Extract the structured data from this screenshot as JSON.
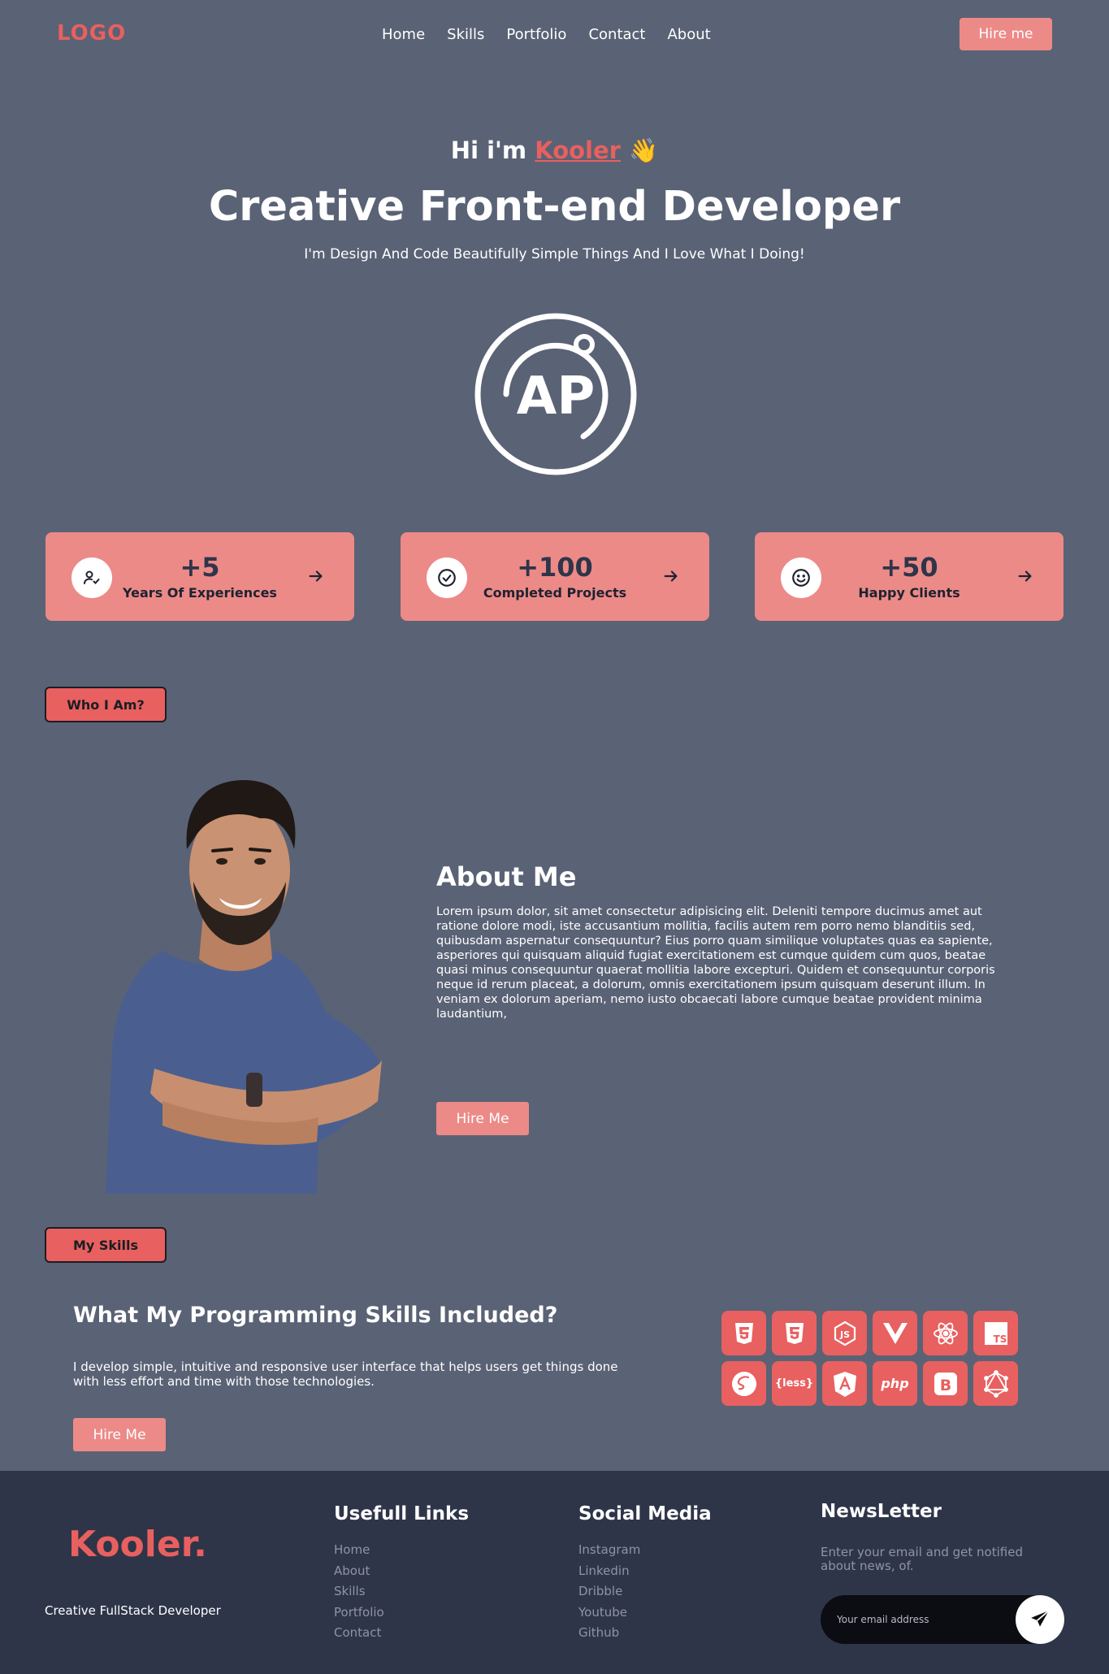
{
  "nav": {
    "logo": "LOGO",
    "links": [
      "Home",
      "Skills",
      "Portfolio",
      "Contact",
      "About"
    ],
    "hire_label": "Hire me"
  },
  "hero": {
    "greeting_prefix": "Hi i'm",
    "name": "Kooler",
    "wave_emoji": "👋",
    "title": "Creative Front-end Developer",
    "subtitle": "I'm Design And Code Beautifully Simple Things And I Love What I Doing!",
    "logo_letters": "AP"
  },
  "stats": [
    {
      "value": "+5",
      "label": "Years Of Experiences",
      "icon": "user-check-icon"
    },
    {
      "value": "+100",
      "label": "Completed Projects",
      "icon": "check-circle-icon"
    },
    {
      "value": "+50",
      "label": "Happy Clients",
      "icon": "smile-icon"
    }
  ],
  "about": {
    "tag": "Who I Am?",
    "title": "About Me",
    "text": "Lorem ipsum dolor, sit amet consectetur adipisicing elit. Deleniti tempore ducimus amet aut ratione dolore modi, iste accusantium mollitia, facilis autem rem porro nemo blanditiis sed, quibusdam aspernatur consequuntur? Eius porro quam similique voluptates quas ea sapiente, asperiores qui quisquam aliquid fugiat exercitationem est cumque quidem cum quos, beatae quasi minus consequuntur quaerat mollitia labore excepturi. Quidem et consequuntur corporis neque id rerum placeat, a dolorum, omnis exercitationem ipsum quisquam deserunt illum. In veniam ex dolorum aperiam, nemo iusto obcaecati labore cumque beatae provident minima laudantium,",
    "hire_label": "Hire Me"
  },
  "skills": {
    "tag": "My Skills",
    "title": "What My Programming Skills Included?",
    "text": "I develop simple, intuitive and responsive user interface that helps users get things done with less effort and time with those technologies.",
    "hire_label": "Hire Me",
    "icons": [
      "html5-icon",
      "css3-icon",
      "javascript-icon",
      "vue-icon",
      "react-icon",
      "typescript-icon",
      "sass-icon",
      "less-icon",
      "angular-icon",
      "php-icon",
      "bootstrap-icon",
      "graphql-icon"
    ],
    "less_text": "{less}",
    "php_text": "php",
    "ts_text": "TS",
    "js_text": "JS",
    "bootstrap_text": "B"
  },
  "footer": {
    "brand": "Kooler.",
    "tagline": "Creative FullStack Developer",
    "links_heading": "Usefull Links",
    "links": [
      "Home",
      "About",
      "Skills",
      "Portfolio",
      "Contact"
    ],
    "social_heading": "Social Media",
    "social": [
      "Instagram",
      "Linkedin",
      "Dribble",
      "Youtube",
      "Github"
    ],
    "newsletter_heading": "NewsLetter",
    "newsletter_text": "Enter your email and get notified about news, of.",
    "email_placeholder": "Your email address"
  },
  "colors": {
    "accent": "#e8605f",
    "card": "#ec8a88",
    "background": "#5a6275",
    "footer": "#2e3549"
  }
}
